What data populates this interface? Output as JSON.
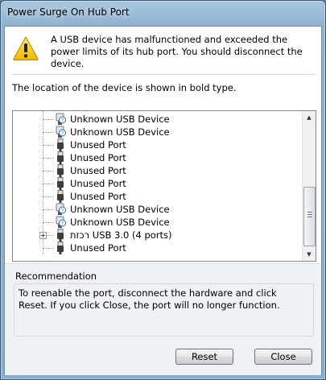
{
  "window": {
    "title": "Power Surge On Hub Port"
  },
  "header": {
    "icon": "warning-icon",
    "message": "A USB device has malfunctioned and exceeded the power limits of its hub port. You should disconnect the device."
  },
  "location_label": "The location of the device is shown in bold type.",
  "tree": {
    "items": [
      {
        "icon": "usb-unknown-device-icon",
        "label": "Unknown USB Device"
      },
      {
        "icon": "usb-unknown-device-icon",
        "label": "Unknown USB Device"
      },
      {
        "icon": "usb-plug-icon",
        "label": "Unused Port"
      },
      {
        "icon": "usb-plug-icon",
        "label": "Unused Port"
      },
      {
        "icon": "usb-plug-icon",
        "label": "Unused Port"
      },
      {
        "icon": "usb-plug-icon",
        "label": "Unused Port"
      },
      {
        "icon": "usb-plug-icon",
        "label": "Unused Port"
      },
      {
        "icon": "usb-unknown-device-icon",
        "label": "Unknown USB Device"
      },
      {
        "icon": "usb-unknown-device-icon",
        "label": "Unknown USB Device"
      },
      {
        "icon": "usb-hub-icon",
        "label": "רכזת USB 3.0 (4 ports)"
      },
      {
        "icon": "usb-plug-icon",
        "label": "Unused Port"
      }
    ]
  },
  "recommendation": {
    "title": "Recommendation",
    "text": "To reenable the port, disconnect the hardware and click Reset. If you click Close, the port will no longer function."
  },
  "buttons": {
    "reset": "Reset",
    "close": "Close"
  }
}
